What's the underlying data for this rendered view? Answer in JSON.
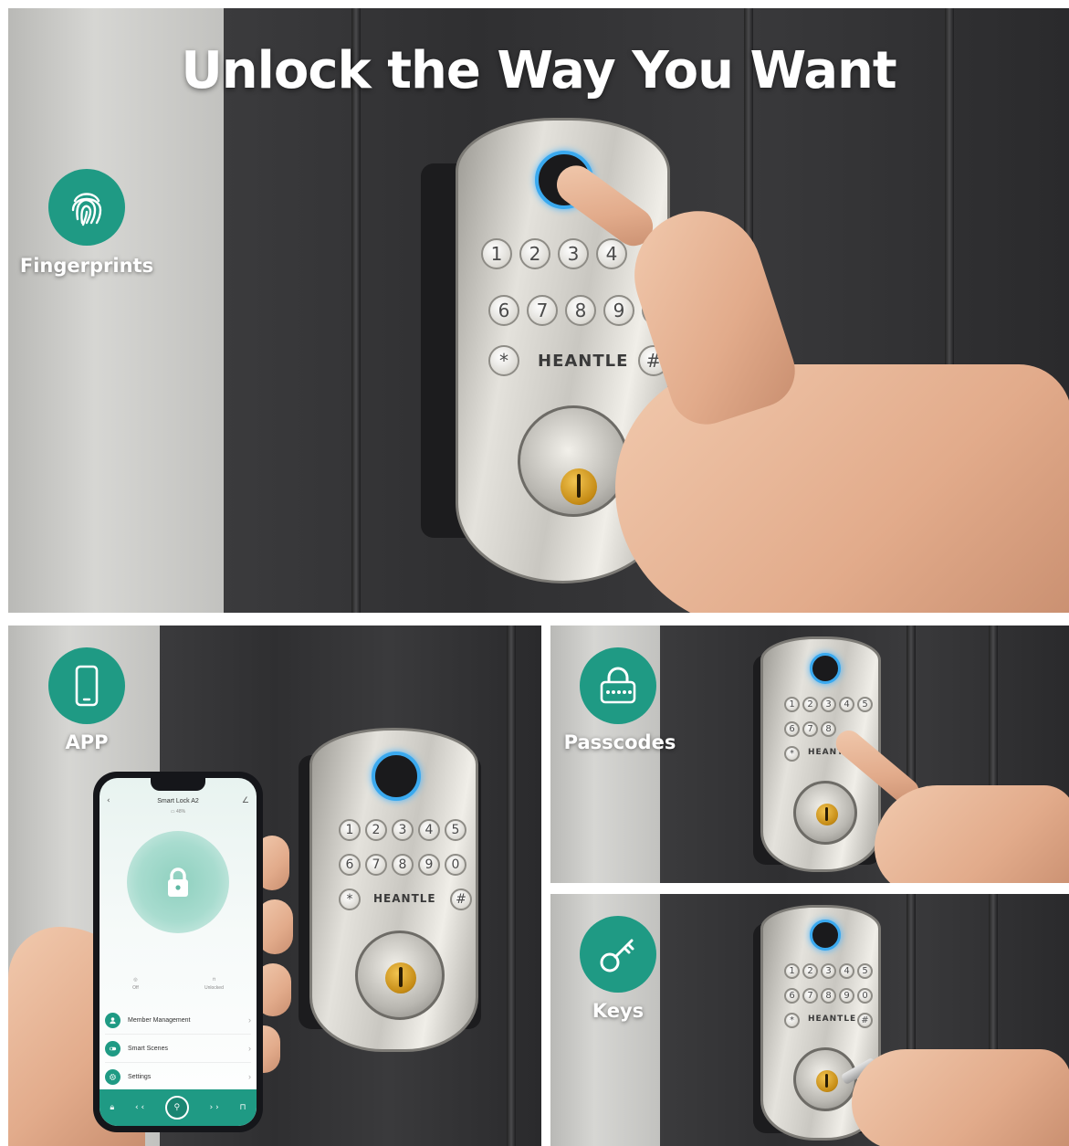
{
  "headline": "Unlock the Way You Want",
  "features": {
    "fingerprints": {
      "label": "Fingerprints",
      "icon": "fingerprint-icon"
    },
    "app": {
      "label": "APP",
      "icon": "smartphone-icon"
    },
    "passcodes": {
      "label": "Passcodes",
      "icon": "keypad-padlock-icon"
    },
    "keys": {
      "label": "Keys",
      "icon": "key-icon"
    }
  },
  "lock": {
    "brand": "HEANTLE",
    "row1": [
      "1",
      "2",
      "3",
      "4",
      "5"
    ],
    "row2": [
      "6",
      "7",
      "8",
      "9",
      "0"
    ],
    "star": "*",
    "hash": "#"
  },
  "phone_app": {
    "title": "Smart Lock A2",
    "battery": "48%",
    "status_left": "Off",
    "status_right": "Unlocked",
    "menu": [
      {
        "label": "Member Management",
        "icon": "user-icon"
      },
      {
        "label": "Smart Scenes",
        "icon": "toggle-icon"
      },
      {
        "label": "Settings",
        "icon": "gear-icon"
      }
    ]
  },
  "colors": {
    "accent": "#1f9a84",
    "fingerprint_ring": "#3aa9ef",
    "headline": "#ffffff"
  }
}
